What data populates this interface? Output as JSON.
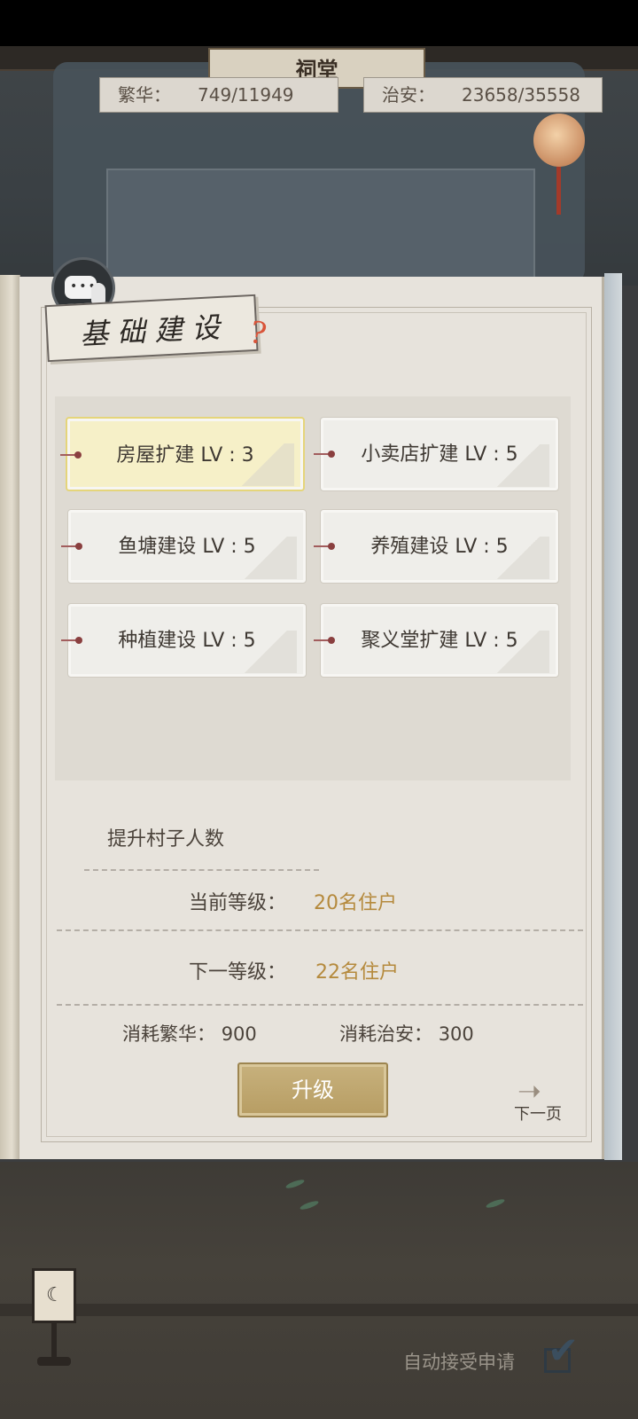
{
  "header": {
    "banner_text": "祠堂",
    "prosperity_label": "繁华：",
    "prosperity_value": "749/11949",
    "security_label": "治安：",
    "security_value": "23658/35558"
  },
  "panel": {
    "title": "基础建设",
    "buildings": [
      {
        "label": "房屋扩建 LV : 3",
        "selected": true
      },
      {
        "label": "小卖店扩建 LV : 5",
        "selected": false
      },
      {
        "label": "鱼塘建设 LV : 5",
        "selected": false
      },
      {
        "label": "养殖建设 LV : 5",
        "selected": false
      },
      {
        "label": "种植建设 LV : 5",
        "selected": false
      },
      {
        "label": "聚义堂扩建 LV : 5",
        "selected": false
      }
    ],
    "detail": {
      "section_title": "提升村子人数",
      "current_level_label": "当前等级：",
      "current_level_value": "20名住户",
      "next_level_label": "下一等级：",
      "next_level_value": "22名住户",
      "cost_prosperity_label": "消耗繁华：",
      "cost_prosperity_value": "900",
      "cost_security_label": "消耗治安：",
      "cost_security_value": "300"
    },
    "upgrade_button": "升级",
    "next_page": "下一页"
  },
  "footer": {
    "auto_accept_label": "自动接受申请",
    "auto_accept_checked": true
  },
  "colors": {
    "accent_gold": "#b58a3d",
    "selected_card": "#f6f0c8",
    "button": "#b79d63",
    "help_icon": "#d9553a"
  }
}
